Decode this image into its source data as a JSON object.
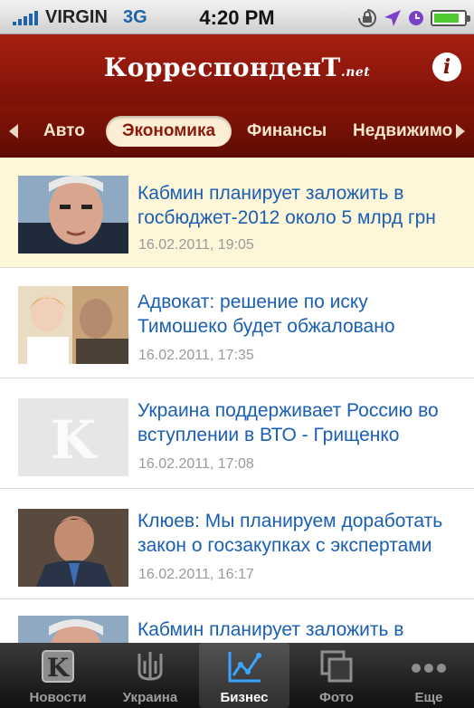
{
  "status_bar": {
    "carrier": "VIRGIN",
    "network": "3G",
    "time": "4:20 PM",
    "signal_bars": 5,
    "battery_level": 0.85
  },
  "header": {
    "logo_main": "КорреспонденТ",
    "logo_suffix": ".net",
    "info_glyph": "i"
  },
  "tabs": [
    {
      "label": "Авто",
      "active": false
    },
    {
      "label": "Экономика",
      "active": true
    },
    {
      "label": "Финансы",
      "active": false
    },
    {
      "label": "Недвижимо",
      "active": false
    }
  ],
  "articles": [
    {
      "title_line1": "Кабмин планирует заложить в",
      "title_line2": "госбюджет-2012 около 5 млрд грн",
      "date": "16.02.2011, 19:05",
      "highlighted": true,
      "thumb": "portrait-man-icon"
    },
    {
      "title_line1": "Адвокат: решение по иску",
      "title_line2": "Тимошеко будет обжаловано",
      "date": "16.02.2011, 17:35",
      "highlighted": false,
      "thumb": "two-people-icon"
    },
    {
      "title_line1": "Украина поддерживает Россию во",
      "title_line2": "вступлении в ВТО - Грищенко",
      "date": "16.02.2011, 17:08",
      "highlighted": false,
      "thumb": "k-placeholder-icon"
    },
    {
      "title_line1": "Клюев: Мы планируем доработать",
      "title_line2": "закон о госзакупках с экспертами",
      "date": "16.02.2011, 16:17",
      "highlighted": false,
      "thumb": "portrait-man-suit-icon"
    },
    {
      "title_line1": "Кабмин планирует заложить в",
      "title_line2": "",
      "date": "",
      "highlighted": false,
      "thumb": "portrait-man-icon"
    }
  ],
  "tab_bar": [
    {
      "label": "Новости",
      "icon": "k-logo-icon",
      "selected": false
    },
    {
      "label": "Украина",
      "icon": "trident-icon",
      "selected": false
    },
    {
      "label": "Бизнес",
      "icon": "chart-icon",
      "selected": true
    },
    {
      "label": "Фото",
      "icon": "photos-icon",
      "selected": false
    },
    {
      "label": "Еще",
      "icon": "more-icon",
      "selected": false
    }
  ],
  "colors": {
    "header_red": "#a62012",
    "link_blue": "#1a5fb4",
    "highlight_bg": "#fdf6d8"
  }
}
